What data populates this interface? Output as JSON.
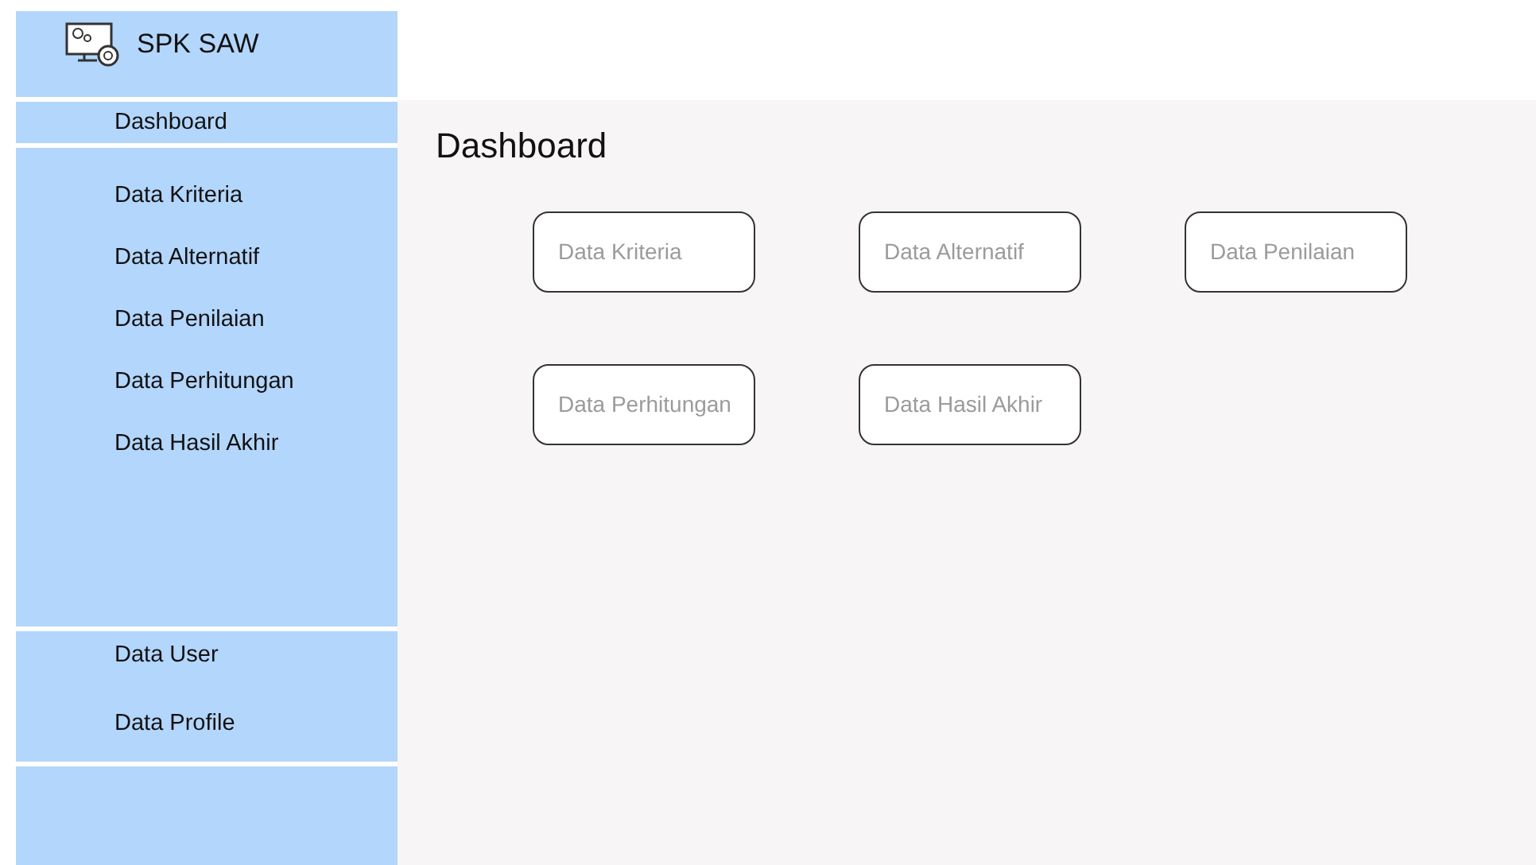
{
  "app": {
    "title": "SPK SAW"
  },
  "sidebar": {
    "top_item": "Dashboard",
    "items": [
      "Data Kriteria",
      "Data Alternatif",
      "Data Penilaian",
      "Data Perhitungan",
      "Data Hasil Akhir"
    ],
    "bottom_items": [
      "Data User",
      "Data Profile"
    ]
  },
  "page_title": "Dashboard",
  "cards": [
    "Data Kriteria",
    "Data Alternatif",
    "Data Penilaian",
    "Data Perhitungan",
    "Data Hasil Akhir"
  ]
}
